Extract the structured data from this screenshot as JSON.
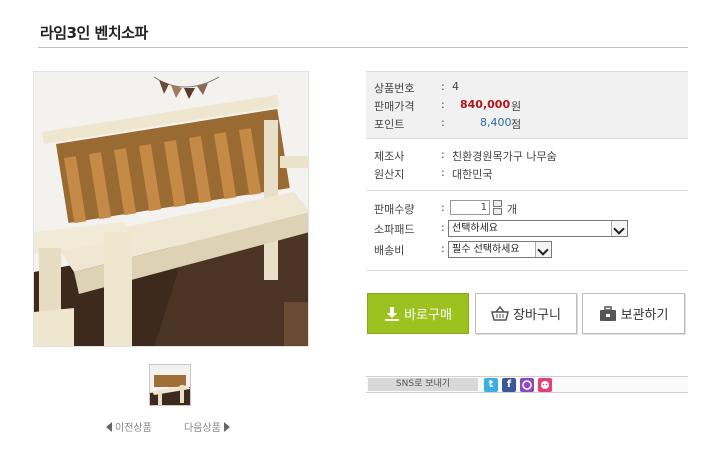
{
  "product": {
    "title": "라임3인 벤치소파"
  },
  "info": {
    "code_label": "상품번호",
    "code_value": "4",
    "price_label": "판매가격",
    "price_value": "840,000",
    "price_unit": "원",
    "point_label": "포인트",
    "point_value": "8,400",
    "point_unit": "점",
    "maker_label": "제조사",
    "maker_value": "친환경원목가구 나무숨",
    "origin_label": "원산지",
    "origin_value": "대한민국",
    "qty_label": "판매수량",
    "qty_value": "1",
    "qty_unit": "개",
    "pad_label": "소파패드",
    "pad_value": "선택하세요",
    "ship_label": "배송비",
    "ship_value": "필수 선택하세요",
    "colon": ":"
  },
  "buttons": {
    "buy": "바로구매",
    "cart": "장바구니",
    "keep": "보관하기"
  },
  "nav": {
    "prev": "이전상품",
    "next": "다음상품"
  },
  "sns": {
    "label": "SNS로 보내기",
    "twitter": "t",
    "facebook": "f",
    "colors": {
      "twitter": "#3ab0e2",
      "facebook": "#3b5998",
      "kakao": "#8a48c9",
      "other": "#e2407a"
    }
  }
}
